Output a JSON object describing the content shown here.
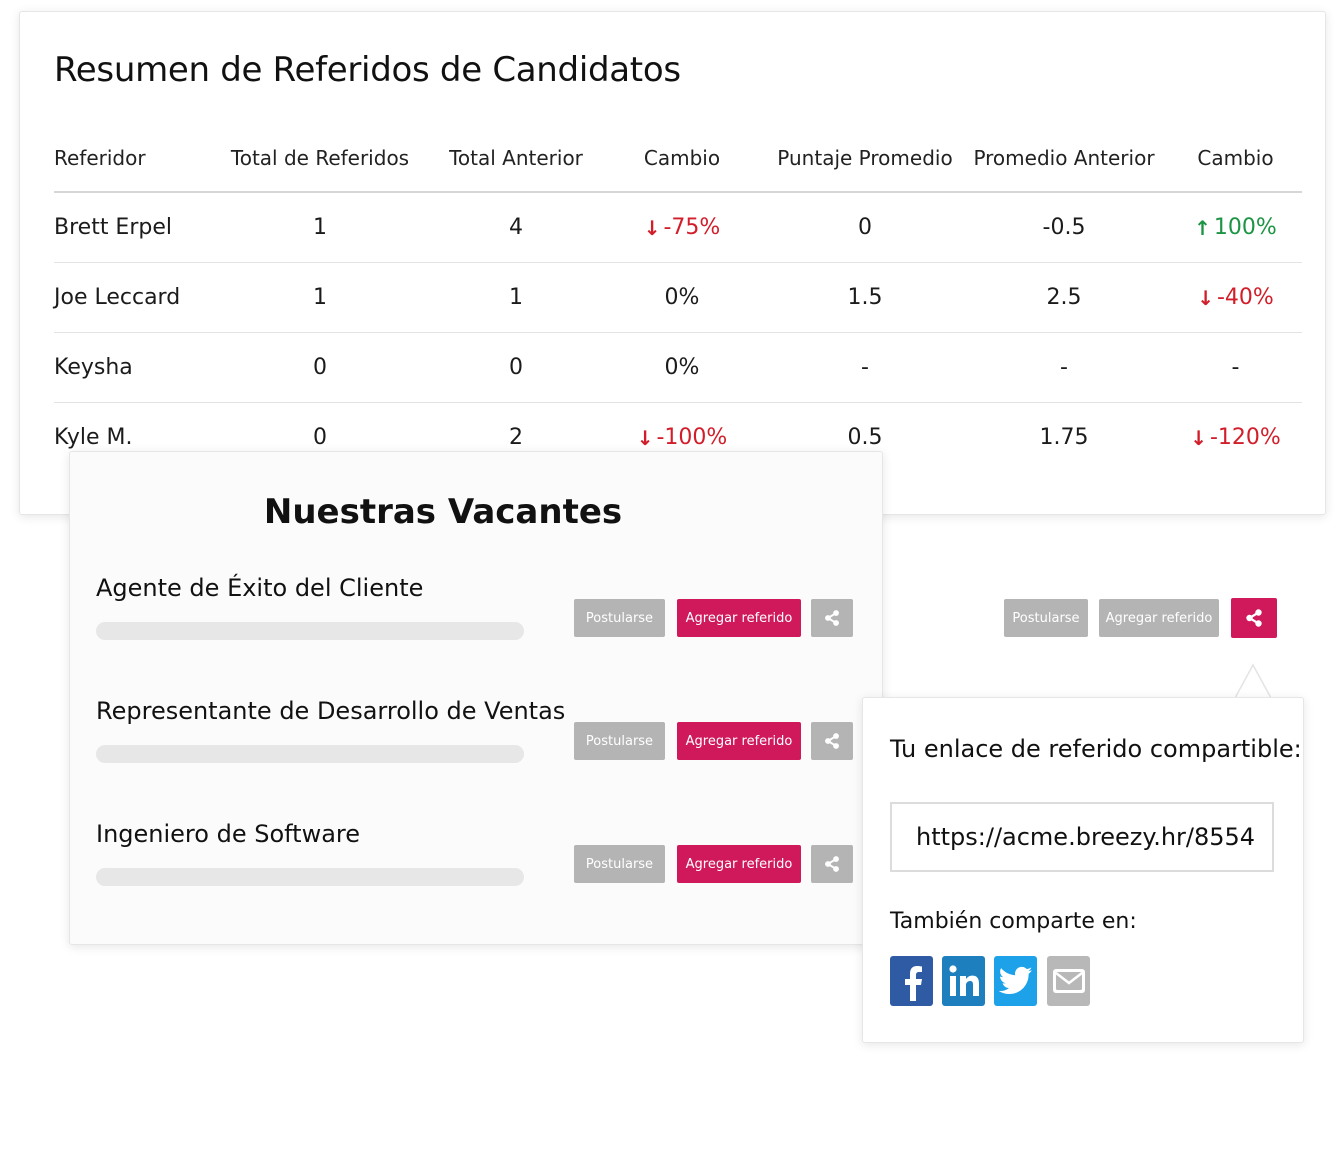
{
  "summary": {
    "title": "Resumen de Referidos de Candidatos",
    "columns": [
      "Referidor",
      "Total de Referidos",
      "Total Anterior",
      "Cambio",
      "Puntaje Promedio",
      "Promedio Anterior",
      "Cambio"
    ],
    "rows": [
      {
        "name": "Brett Erpel",
        "total": "1",
        "prev_total": "4",
        "change": "-75%",
        "change_dir": "down",
        "avg": "0",
        "prev_avg": "-0.5",
        "avg_change": "100%",
        "avg_change_dir": "up"
      },
      {
        "name": "Joe Leccard",
        "total": "1",
        "prev_total": "1",
        "change": "0%",
        "change_dir": "none",
        "avg": "1.5",
        "prev_avg": "2.5",
        "avg_change": "-40%",
        "avg_change_dir": "down"
      },
      {
        "name": "Keysha",
        "total": "0",
        "prev_total": "0",
        "change": "0%",
        "change_dir": "none",
        "avg": "-",
        "prev_avg": "-",
        "avg_change": "-",
        "avg_change_dir": "none"
      },
      {
        "name": "Kyle M.",
        "total": "0",
        "prev_total": "2",
        "change": "-100%",
        "change_dir": "down",
        "avg": "0.5",
        "prev_avg": "1.75",
        "avg_change": "-120%",
        "avg_change_dir": "down"
      }
    ],
    "colors": {
      "negative": "#d11e2a",
      "positive": "#1d9444"
    }
  },
  "vacancies": {
    "title": "Nuestras Vacantes",
    "jobs": [
      {
        "title": "Agente de Éxito del Cliente"
      },
      {
        "title": "Representante de Desarrollo de Ventas"
      },
      {
        "title": "Ingeniero de Software"
      }
    ],
    "apply_label": "Postularse",
    "refer_label": "Agregar referido",
    "share_icon": "share-icon"
  },
  "floating": {
    "apply_label": "Postularse",
    "refer_label": "Agregar referido",
    "share_icon": "share-icon"
  },
  "popover": {
    "title": "Tu enlace de referido compartible:",
    "link": "https://acme.breezy.hr/8554",
    "also_share": "También comparte en:",
    "networks": [
      "facebook-icon",
      "linkedin-icon",
      "twitter-icon",
      "email-icon"
    ]
  },
  "brand": {
    "accent": "#d0195b",
    "button_grey": "#b4b4b4"
  }
}
